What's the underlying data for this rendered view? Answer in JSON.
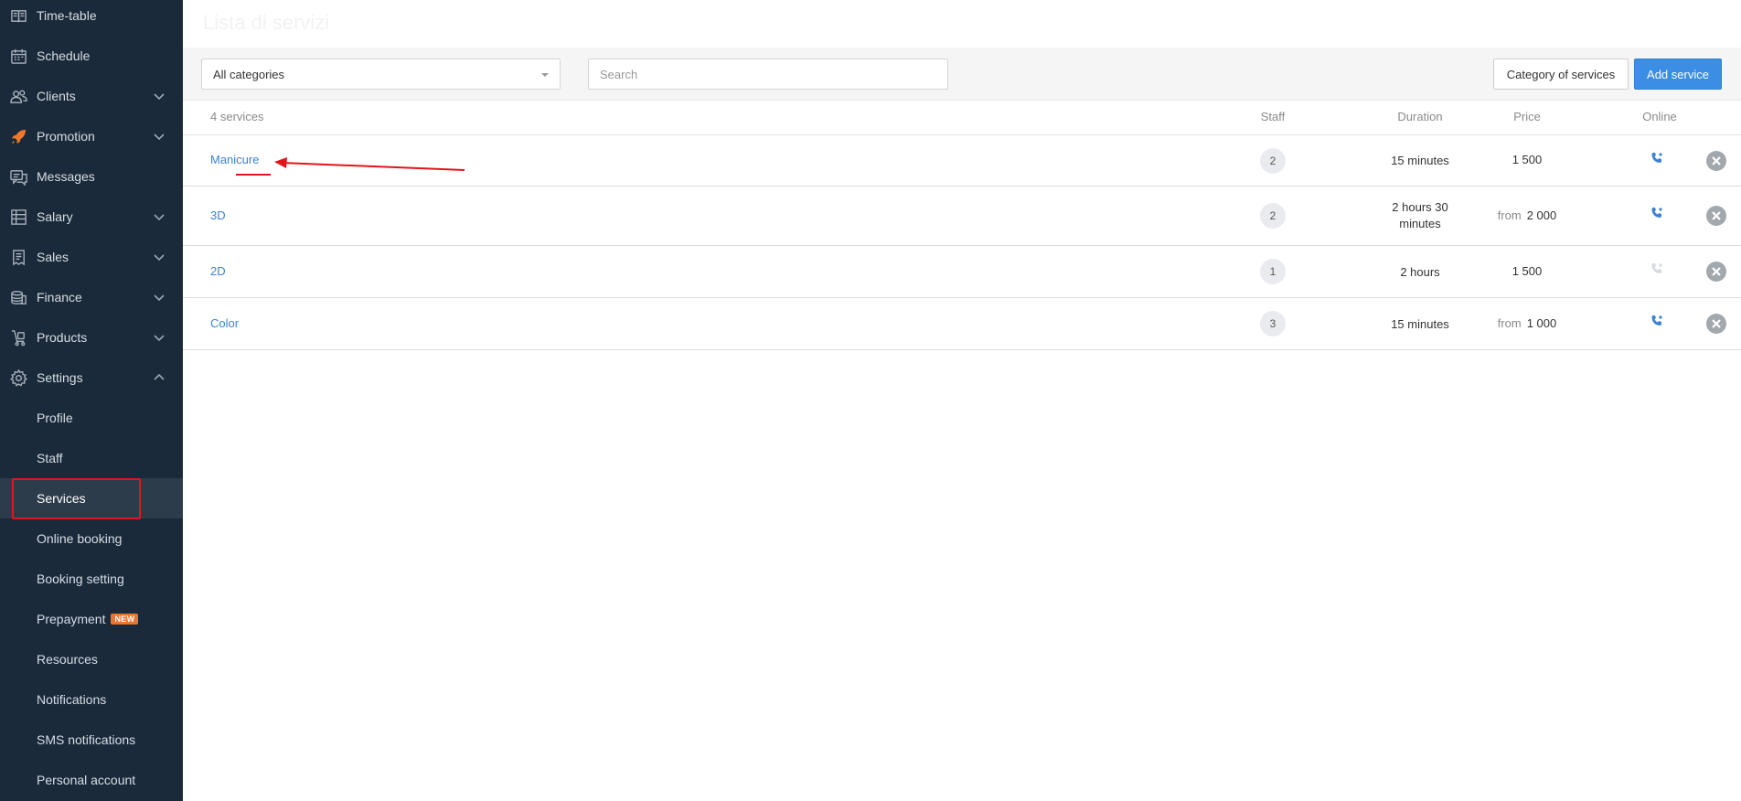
{
  "colors": {
    "sidebar_bg": "#1b2a3a",
    "accent": "#3b8ee3",
    "link": "#3b82d6",
    "highlight": "#e3151a",
    "badge": "#e8772e"
  },
  "sidebar": {
    "items": [
      {
        "label": "Time-table",
        "icon": "book-icon"
      },
      {
        "label": "Schedule",
        "icon": "calendar-icon"
      },
      {
        "label": "Clients",
        "icon": "users-icon"
      },
      {
        "label": "Promotion",
        "icon": "rocket-icon"
      },
      {
        "label": "Messages",
        "icon": "chat-icon"
      },
      {
        "label": "Salary",
        "icon": "ledger-icon"
      },
      {
        "label": "Sales",
        "icon": "receipt-icon"
      },
      {
        "label": "Finance",
        "icon": "coins-icon"
      },
      {
        "label": "Products",
        "icon": "cart-icon"
      },
      {
        "label": "Settings",
        "icon": "gear-icon"
      }
    ],
    "settings_sub": [
      {
        "label": "Profile"
      },
      {
        "label": "Staff"
      },
      {
        "label": "Services"
      },
      {
        "label": "Online booking"
      },
      {
        "label": "Booking setting"
      },
      {
        "label": "Prepayment",
        "badge": "NEW"
      },
      {
        "label": "Resources"
      },
      {
        "label": "Notifications"
      },
      {
        "label": "SMS notifications"
      },
      {
        "label": "Personal account"
      }
    ]
  },
  "main": {
    "title": "Lista di servizi",
    "filter": {
      "category_value": "All categories",
      "search_placeholder": "Search"
    },
    "buttons": {
      "category": "Category of services",
      "add": "Add service"
    },
    "table": {
      "count_label": "4 services",
      "headers": {
        "staff": "Staff",
        "duration": "Duration",
        "price": "Price",
        "online": "Online"
      },
      "rows": [
        {
          "name": "Manicure",
          "staff": "2",
          "duration": "15 minutes",
          "price_prefix": "",
          "price": "1 500",
          "online": true
        },
        {
          "name": "3D",
          "staff": "2",
          "duration": "2 hours 30 minutes",
          "price_prefix": "from",
          "price": "2 000",
          "online": true
        },
        {
          "name": "2D",
          "staff": "1",
          "duration": "2 hours",
          "price_prefix": "",
          "price": "1 500",
          "online": false
        },
        {
          "name": "Color",
          "staff": "3",
          "duration": "15 minutes",
          "price_prefix": "from",
          "price": "1 000",
          "online": true
        }
      ]
    }
  }
}
